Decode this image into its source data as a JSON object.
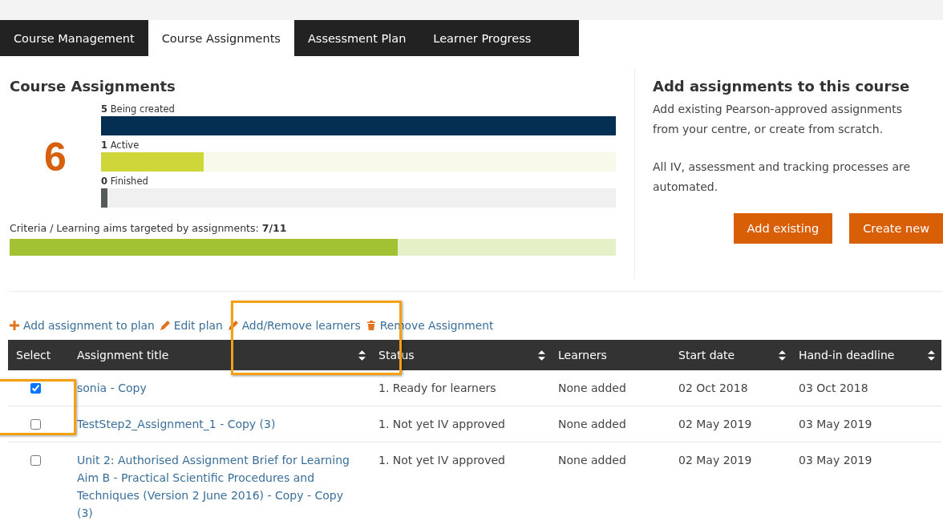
{
  "tabs": [
    {
      "label": "Course Management",
      "selected": false
    },
    {
      "label": "Course Assignments",
      "selected": true
    },
    {
      "label": "Assessment Plan",
      "selected": false
    },
    {
      "label": "Learner Progress",
      "selected": false
    }
  ],
  "summary": {
    "title": "Course Assignments",
    "total": "6",
    "bars": [
      {
        "count": "5",
        "label": "Being created",
        "level": 1,
        "kind": "created"
      },
      {
        "count": "1",
        "label": "Active",
        "level": 0.2,
        "kind": "active"
      },
      {
        "count": "0",
        "label": "Finished",
        "level": 0.012,
        "kind": "finished"
      }
    ],
    "criteria": {
      "label": "Criteria / Learning aims targeted by assignments:",
      "value": "7/11",
      "level": 0.64
    }
  },
  "side": {
    "title": "Add assignments to this course",
    "paragraphs": [
      "Add existing Pearson-approved assignments from your centre, or create from scratch.",
      "All IV, assessment and tracking processes are automated."
    ],
    "buttons": [
      "Add existing",
      "Create new"
    ]
  },
  "actions": [
    {
      "label": "Add assignment to plan",
      "kind": "plus"
    },
    {
      "label": "Edit plan",
      "kind": "pencil"
    },
    {
      "label": "Add/Remove learners",
      "kind": "pencil"
    },
    {
      "label": "Remove Assignment",
      "kind": "trash"
    }
  ],
  "table": {
    "columns": [
      {
        "label": "Select",
        "sortable": false
      },
      {
        "label": "Assignment title",
        "sortable": true
      },
      {
        "label": "Status",
        "sortable": true
      },
      {
        "label": "Learners",
        "sortable": false
      },
      {
        "label": "Start date",
        "sortable": true
      },
      {
        "label": "Hand-in deadline",
        "sortable": true
      }
    ],
    "rows": [
      {
        "checked": true,
        "title": "sonia - Copy",
        "status": "1. Ready for learners",
        "learners": "None added",
        "start": "02 Oct 2018",
        "deadline": "03 Oct 2018"
      },
      {
        "checked": false,
        "title": "TestStep2_Assignment_1 - Copy (3)",
        "status": "1. Not yet IV approved",
        "learners": "None added",
        "start": "02 May 2019",
        "deadline": "03 May 2019"
      },
      {
        "checked": false,
        "title": "Unit 2: Authorised Assignment Brief for Learning Aim B - Practical Scientific Procedures and Techniques (Version 2 June 2016) - Copy - Copy (3)",
        "status": "1. Not yet IV approved",
        "learners": "None added",
        "start": "02 May 2019",
        "deadline": "03 May 2019"
      }
    ]
  }
}
